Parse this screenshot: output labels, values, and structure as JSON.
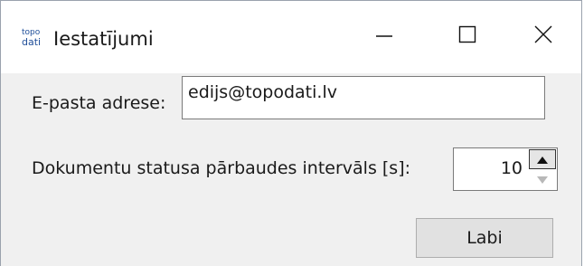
{
  "window": {
    "title": "Iestatījumi",
    "app_icon": {
      "name": "topodati-logo-icon",
      "text_top": "topo",
      "text_bottom": "dati",
      "color": "#1f4e99"
    },
    "controls": {
      "minimize": "minimize-icon",
      "maximize": "maximize-icon",
      "close": "close-icon"
    }
  },
  "form": {
    "email": {
      "label": "E-pasta adrese:",
      "value": "edijs@topodati.lv"
    },
    "interval": {
      "label": "Dokumentu statusa pārbaudes intervāls [s]:",
      "value": "10"
    },
    "ok_label": "Labi"
  },
  "colors": {
    "content_bg": "#f0f0f0",
    "button_bg": "#e1e1e1",
    "border": "#7a7a7a"
  }
}
